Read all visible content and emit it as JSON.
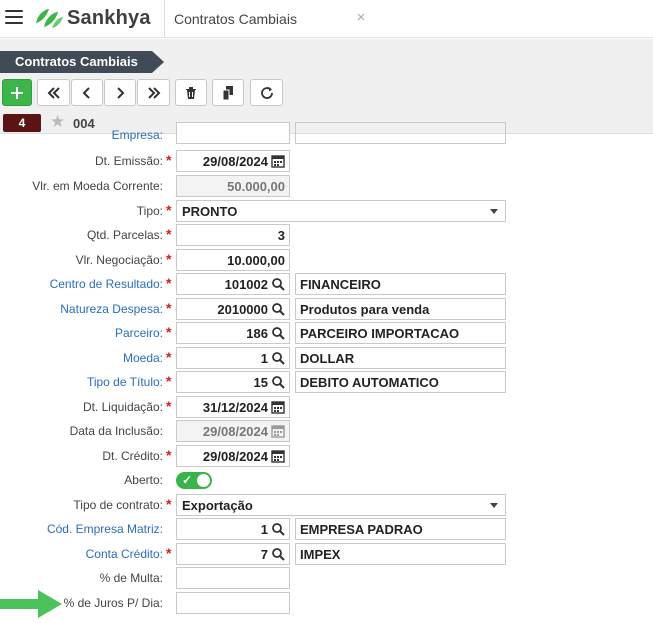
{
  "header": {
    "brand": "Sankhya",
    "tab_title": "Contratos Cambiais",
    "close_glyph": "×"
  },
  "toolbar": {
    "breadcrumb": "Contratos Cambiais",
    "record_index": "4",
    "record_code": "004",
    "buttons": [
      "add",
      "first",
      "previous",
      "next",
      "last",
      "delete",
      "duplicate",
      "refresh"
    ]
  },
  "form": {
    "empresa": {
      "label": "Empresa:"
    },
    "dt_emissao": {
      "label": "Dt. Emissão:",
      "value": "29/08/2024"
    },
    "vlr_moeda_corrente": {
      "label": "Vlr. em Moeda Corrente:",
      "value": "50.000,00"
    },
    "tipo": {
      "label": "Tipo:",
      "value": "PRONTO"
    },
    "qtd_parcelas": {
      "label": "Qtd. Parcelas:",
      "value": "3"
    },
    "vlr_negociacao": {
      "label": "Vlr. Negociação:",
      "value": "10.000,00"
    },
    "centro_resultado": {
      "label": "Centro de Resultado:",
      "code": "101002",
      "desc": "FINANCEIRO"
    },
    "natureza_despesa": {
      "label": "Natureza Despesa:",
      "code": "2010000",
      "desc": "Produtos para venda"
    },
    "parceiro": {
      "label": "Parceiro:",
      "code": "186",
      "desc": "PARCEIRO IMPORTACAO"
    },
    "moeda": {
      "label": "Moeda:",
      "code": "1",
      "desc": "DOLLAR"
    },
    "tipo_titulo": {
      "label": "Tipo de Título:",
      "code": "15",
      "desc": "DEBITO AUTOMATICO"
    },
    "dt_liquidacao": {
      "label": "Dt. Liquidação:",
      "value": "31/12/2024"
    },
    "data_inclusao": {
      "label": "Data da Inclusão:",
      "value": "29/08/2024"
    },
    "dt_credito": {
      "label": "Dt. Crédito:",
      "value": "29/08/2024"
    },
    "aberto": {
      "label": "Aberto:",
      "checked": true
    },
    "tipo_contrato": {
      "label": "Tipo de contrato:",
      "value": "Exportação"
    },
    "cod_empresa_matriz": {
      "label": "Cód. Empresa Matriz:",
      "code": "1",
      "desc": "EMPRESA PADRAO"
    },
    "conta_credito": {
      "label": "Conta Crédito:",
      "code": "7",
      "desc": "IMPEX"
    },
    "pct_multa": {
      "label": "% de Multa:",
      "value": ""
    },
    "pct_juros_dia": {
      "label": "% de Juros P/ Dia:",
      "value": ""
    }
  },
  "colors": {
    "brand_green": "#3cb54a",
    "link_blue": "#2a6ebb",
    "required_red": "#d21f1f",
    "breadcrumb_bg": "#414b55",
    "record_badge_bg": "#5a1414"
  }
}
